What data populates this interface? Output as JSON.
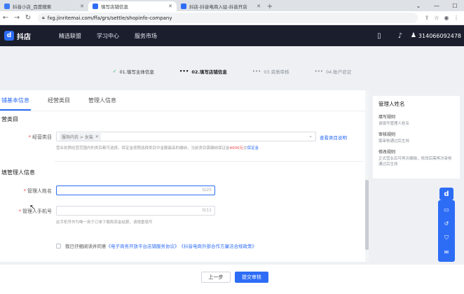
{
  "browser": {
    "tabs": [
      {
        "label": "抖音小店_百度搜索",
        "color": "#3b7bf6",
        "active": false
      },
      {
        "label": "填写店铺信息",
        "color": "#2d6df6",
        "active": true
      },
      {
        "label": "抖店-抖音电商入驻-抖音开店",
        "color": "#2d6df6",
        "active": false
      }
    ],
    "url": "fxg.jinritemai.com/ffa/grs/settle/shopinfo-company"
  },
  "header": {
    "logo_text": "抖店",
    "nav": [
      "精选联盟",
      "学习中心",
      "服务市场"
    ],
    "user_id": "3140660924​78"
  },
  "steps": [
    {
      "label": "01.填写主体信息",
      "state": "done"
    },
    {
      "label": "02.填写店铺信息",
      "state": "current"
    },
    {
      "label": "03.资质审核",
      "state": "todo"
    },
    {
      "label": "04.账户验证",
      "state": "todo"
    }
  ],
  "form": {
    "tabs": [
      "铺基本信息",
      "经营类目",
      "管理人信息"
    ],
    "section1_title": "营类目",
    "category_label": "经营类目",
    "category_chip": "服饰内衣 > 女装",
    "category_link": "查看类目说明",
    "category_hint_a": "营业执照经营范围内的类目都可选择，保证金按照选择类目中金额最高的缴纳，当前类目需缴纳保证金",
    "category_hint_amount": "4000元",
    "category_hint_b": "交",
    "category_hint_link": "保证金",
    "section2_title": "填管理人信息",
    "name_label": "管理人姓名",
    "name_counter": "0/25",
    "phone_label": "管理人手机号",
    "phone_counter": "0/11",
    "phone_hint": "此手机号作为唯一用于订单下载和资金结算，请慎重填写",
    "agree_prefix": "我已仔细阅读并同意",
    "agree_link1": "《电子商务开放平台店铺服务协议》",
    "agree_link2": "《抖音电商外部合作方廉洁合规政策》"
  },
  "help": {
    "title": "管理人姓名",
    "sections": [
      {
        "head": "填写规则",
        "desc": "请填写管理人姓名"
      },
      {
        "head": "审核规则",
        "desc": "需审核通过后生效"
      },
      {
        "head": "修改规则",
        "desc": "正式营业后可再次编辑，修改后需再次审核通过后生效"
      }
    ]
  },
  "buttons": {
    "prev": "上一步",
    "submit": "提交审核"
  },
  "colors": {
    "accent": "#2d6df6",
    "header_bg": "#1b1e2d",
    "required": "#f04545",
    "done_step": "#2eb86e"
  }
}
